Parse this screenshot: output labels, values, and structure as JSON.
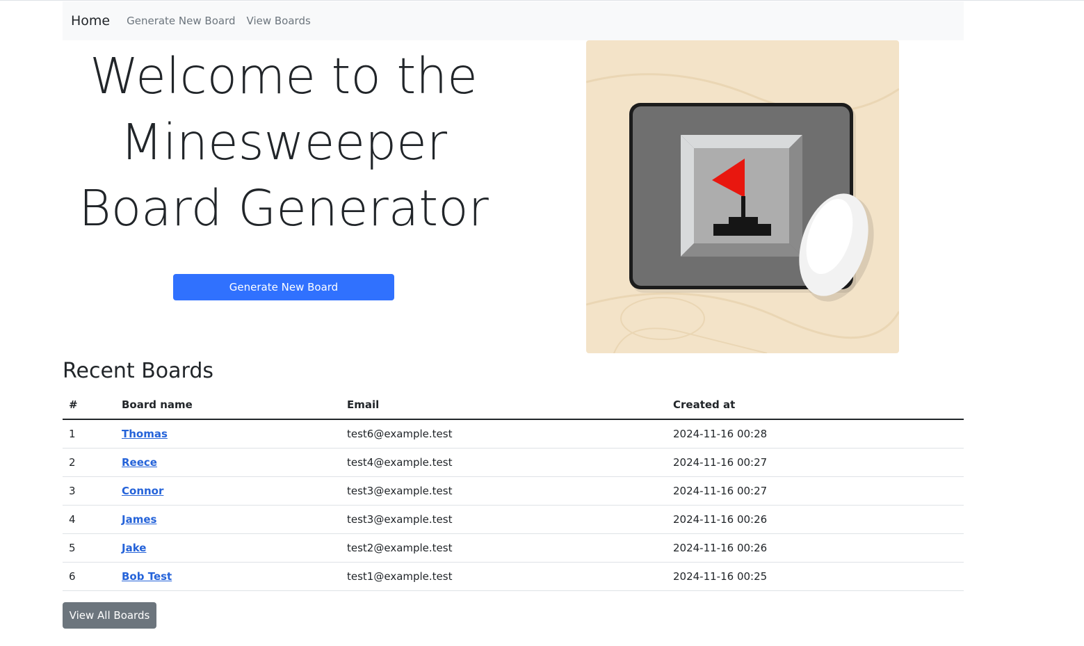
{
  "navbar": {
    "brand": "Home",
    "links": [
      "Generate New Board",
      "View Boards"
    ]
  },
  "hero": {
    "title_lines": [
      "Welcome to the",
      "Minesweeper",
      "Board Generator"
    ],
    "button_label": "Generate New Board",
    "image_icon": "minesweeper-flag-mousepad-image"
  },
  "recent": {
    "title": "Recent Boards",
    "columns": [
      "#",
      "Board name",
      "Email",
      "Created at"
    ],
    "rows": [
      {
        "num": "1",
        "name": "Thomas",
        "email": "test6@example.test",
        "created": "2024-11-16 00:28"
      },
      {
        "num": "2",
        "name": "Reece",
        "email": "test4@example.test",
        "created": "2024-11-16 00:27"
      },
      {
        "num": "3",
        "name": "Connor",
        "email": "test3@example.test",
        "created": "2024-11-16 00:27"
      },
      {
        "num": "4",
        "name": "James",
        "email": "test3@example.test",
        "created": "2024-11-16 00:26"
      },
      {
        "num": "5",
        "name": "Jake",
        "email": "test2@example.test",
        "created": "2024-11-16 00:26"
      },
      {
        "num": "6",
        "name": "Bob Test",
        "email": "test1@example.test",
        "created": "2024-11-16 00:25"
      }
    ],
    "view_all_label": "View All Boards"
  },
  "colors": {
    "primary": "#3071fe",
    "secondary": "#6c757d",
    "link": "#2563d9",
    "navbar_bg": "#f8f9fa"
  }
}
